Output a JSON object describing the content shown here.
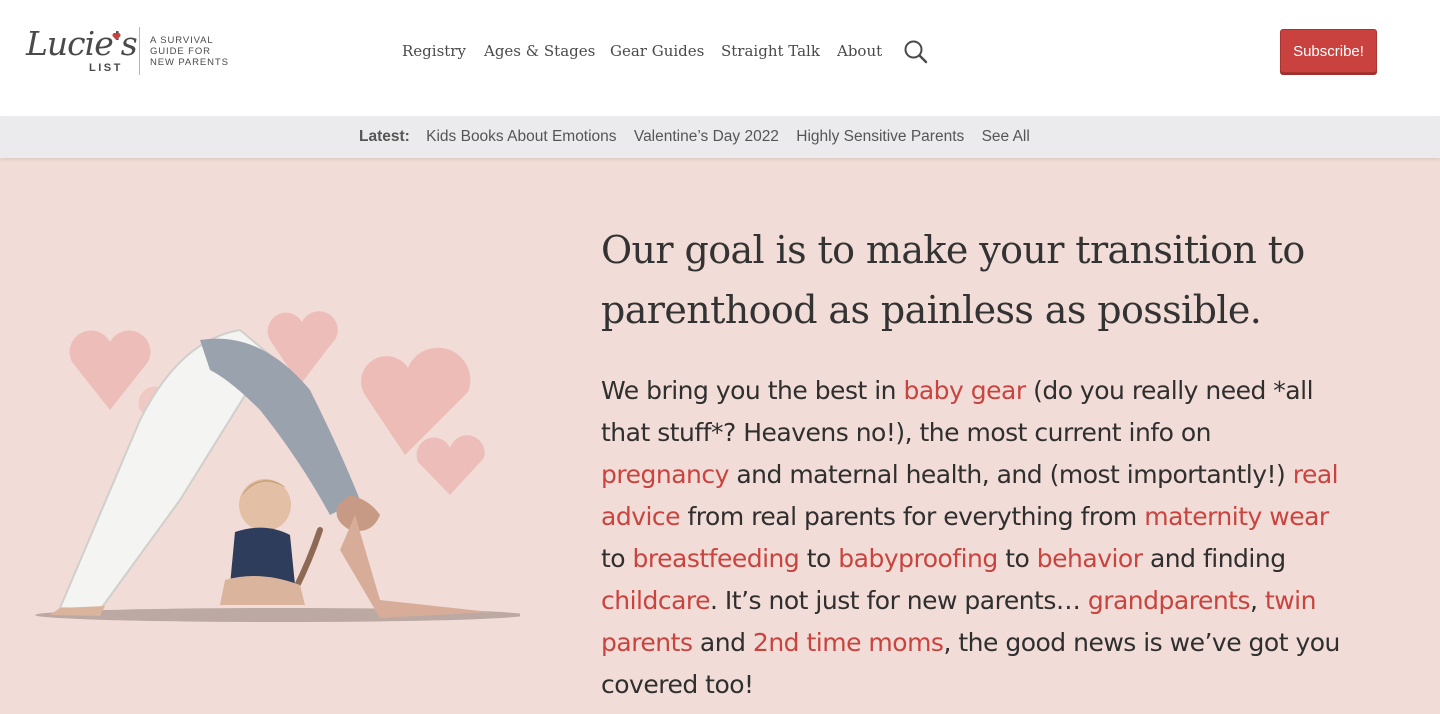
{
  "brand": {
    "script_name": "Lucie's",
    "list_word": "LIST",
    "tagline_lines": [
      "A SURVIVAL",
      "GUIDE FOR",
      "NEW PARENTS"
    ],
    "heart_color": "#c9423f"
  },
  "nav": {
    "items": [
      {
        "label": "Registry"
      },
      {
        "label": "Ages & Stages"
      },
      {
        "label": "Gear Guides"
      },
      {
        "label": "Straight Talk"
      },
      {
        "label": "About"
      }
    ],
    "search_icon": "search-icon"
  },
  "subscribe": {
    "label": "Subscribe!",
    "color": "#c9423f"
  },
  "latest": {
    "label": "Latest:",
    "links": [
      {
        "label": "Kids Books About Emotions"
      },
      {
        "label": "Valentine’s Day 2022"
      },
      {
        "label": "Highly Sensitive Parents"
      },
      {
        "label": "See All"
      }
    ]
  },
  "hero": {
    "headline": "Our goal is to make your transition to parenthood as painless as possible.",
    "body": {
      "t1": "We bring you the best in ",
      "l_baby_gear": "baby gear",
      "t2": " (do you really need *all that stuff*? Heavens no!), the most current info on ",
      "l_pregnancy": "pregnancy",
      "t3": " and maternal health, and (most importantly!) ",
      "l_real_advice": "real advice",
      "t4": " from real parents for everything from ",
      "l_maternity_wear": "maternity wear",
      "t5": " to ",
      "l_breastfeeding": "breastfeeding",
      "t6": " to ",
      "l_babyproofing": "babyproofing",
      "t7": " to ",
      "l_behavior": "behavior",
      "t8": " and finding ",
      "l_childcare": "childcare",
      "t9": ". It’s not just for new parents… ",
      "l_grandparents": "grandparents",
      "t10": ", ",
      "l_twin_parents": "twin parents",
      "t11": " and ",
      "l_2nd_time_moms": "2nd time moms",
      "t12": ", the good news is we’ve got you covered too!"
    },
    "background": "#f2dcd7",
    "link_color": "#c9443f"
  }
}
